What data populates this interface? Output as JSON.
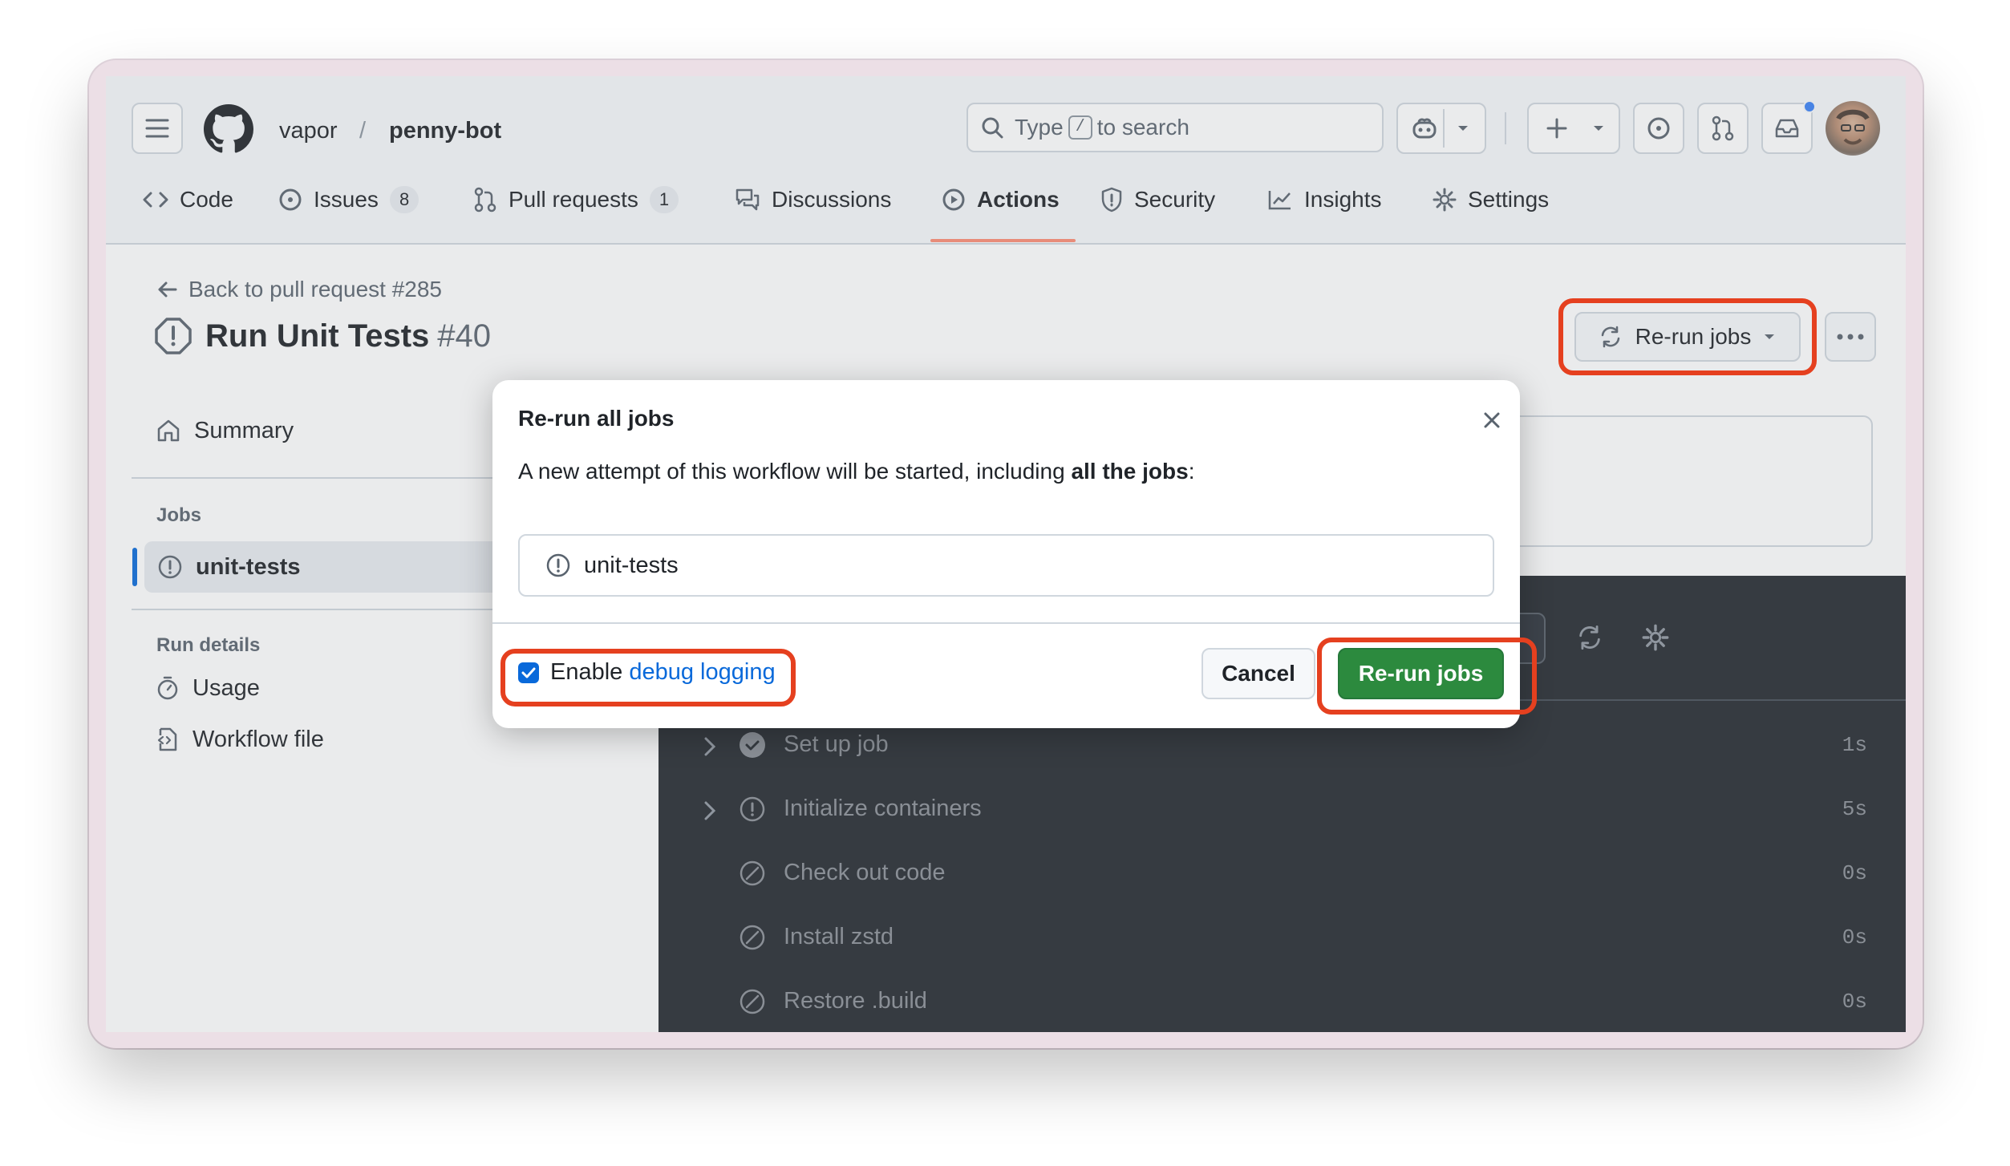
{
  "repo": {
    "owner": "vapor",
    "separator": "/",
    "name": "penny-bot"
  },
  "search": {
    "prefix": "Type",
    "key": "/",
    "suffix": "to search"
  },
  "tabs": [
    {
      "label": "Code",
      "icon": "code-icon"
    },
    {
      "label": "Issues",
      "icon": "issue-opened-icon",
      "count": "8"
    },
    {
      "label": "Pull requests",
      "icon": "git-pull-request-icon",
      "count": "1"
    },
    {
      "label": "Discussions",
      "icon": "comment-discussion-icon"
    },
    {
      "label": "Actions",
      "icon": "play-icon",
      "selected": true
    },
    {
      "label": "Security",
      "icon": "shield-icon"
    },
    {
      "label": "Insights",
      "icon": "graph-icon"
    },
    {
      "label": "Settings",
      "icon": "gear-icon"
    }
  ],
  "run": {
    "back_link": "Back to pull request #285",
    "title": "Run Unit Tests",
    "number": "#40",
    "rerun_button": "Re-run jobs"
  },
  "sidebar": {
    "summary": "Summary",
    "jobs_heading": "Jobs",
    "job": "unit-tests",
    "details_heading": "Run details",
    "usage": "Usage",
    "workflow_file": "Workflow file"
  },
  "steps": [
    {
      "name": "Set up job",
      "time": "1s",
      "status": "success",
      "expandable": true
    },
    {
      "name": "Initialize containers",
      "time": "5s",
      "status": "alert",
      "expandable": true
    },
    {
      "name": "Check out code",
      "time": "0s",
      "status": "skipped",
      "expandable": false
    },
    {
      "name": "Install zstd",
      "time": "0s",
      "status": "skipped",
      "expandable": false
    },
    {
      "name": "Restore .build",
      "time": "0s",
      "status": "skipped",
      "expandable": false
    }
  ],
  "modal": {
    "title": "Re-run all jobs",
    "description_prefix": "A new attempt of this workflow will be started, including ",
    "description_bold": "all the jobs",
    "description_suffix": ":",
    "job": "unit-tests",
    "checkbox_prefix": "Enable ",
    "checkbox_link": "debug logging",
    "checkbox_checked": true,
    "cancel": "Cancel",
    "confirm": "Re-run jobs"
  },
  "colors": {
    "primary_green": "#2c8a3e",
    "annotation": "#e5401f",
    "link": "#0969da",
    "accent_underline": "#fd8c73"
  }
}
